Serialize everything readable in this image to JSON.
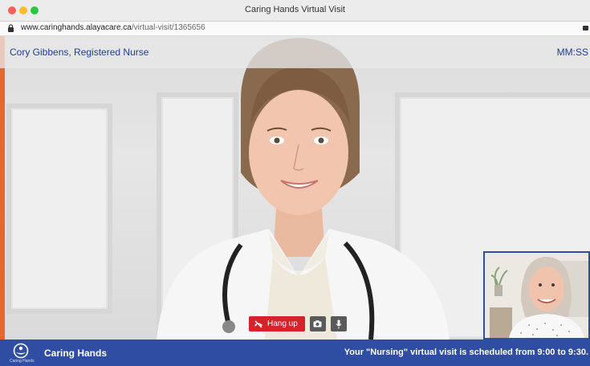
{
  "window": {
    "title": "Caring Hands Virtual Visit"
  },
  "address": {
    "domain": "www.caringhands.alayacare.ca",
    "path": "/virtual-visit/1365656"
  },
  "call": {
    "caller_name": "Cory Gibbens, Registered Nurse",
    "timer": "MM:SS"
  },
  "controls": {
    "hangup_label": "Hang up",
    "icons": [
      "phone-hangup-icon",
      "camera-icon",
      "microphone-icon"
    ],
    "hangup_color": "#d7212b"
  },
  "footer": {
    "brand": "Caring Hands",
    "logo_text": "Caring Hands",
    "schedule": "Your \"Nursing\" virtual visit is scheduled from 9:00 to 9:30.",
    "color": "#2f4ea3"
  },
  "accent_color": "#e8672a"
}
